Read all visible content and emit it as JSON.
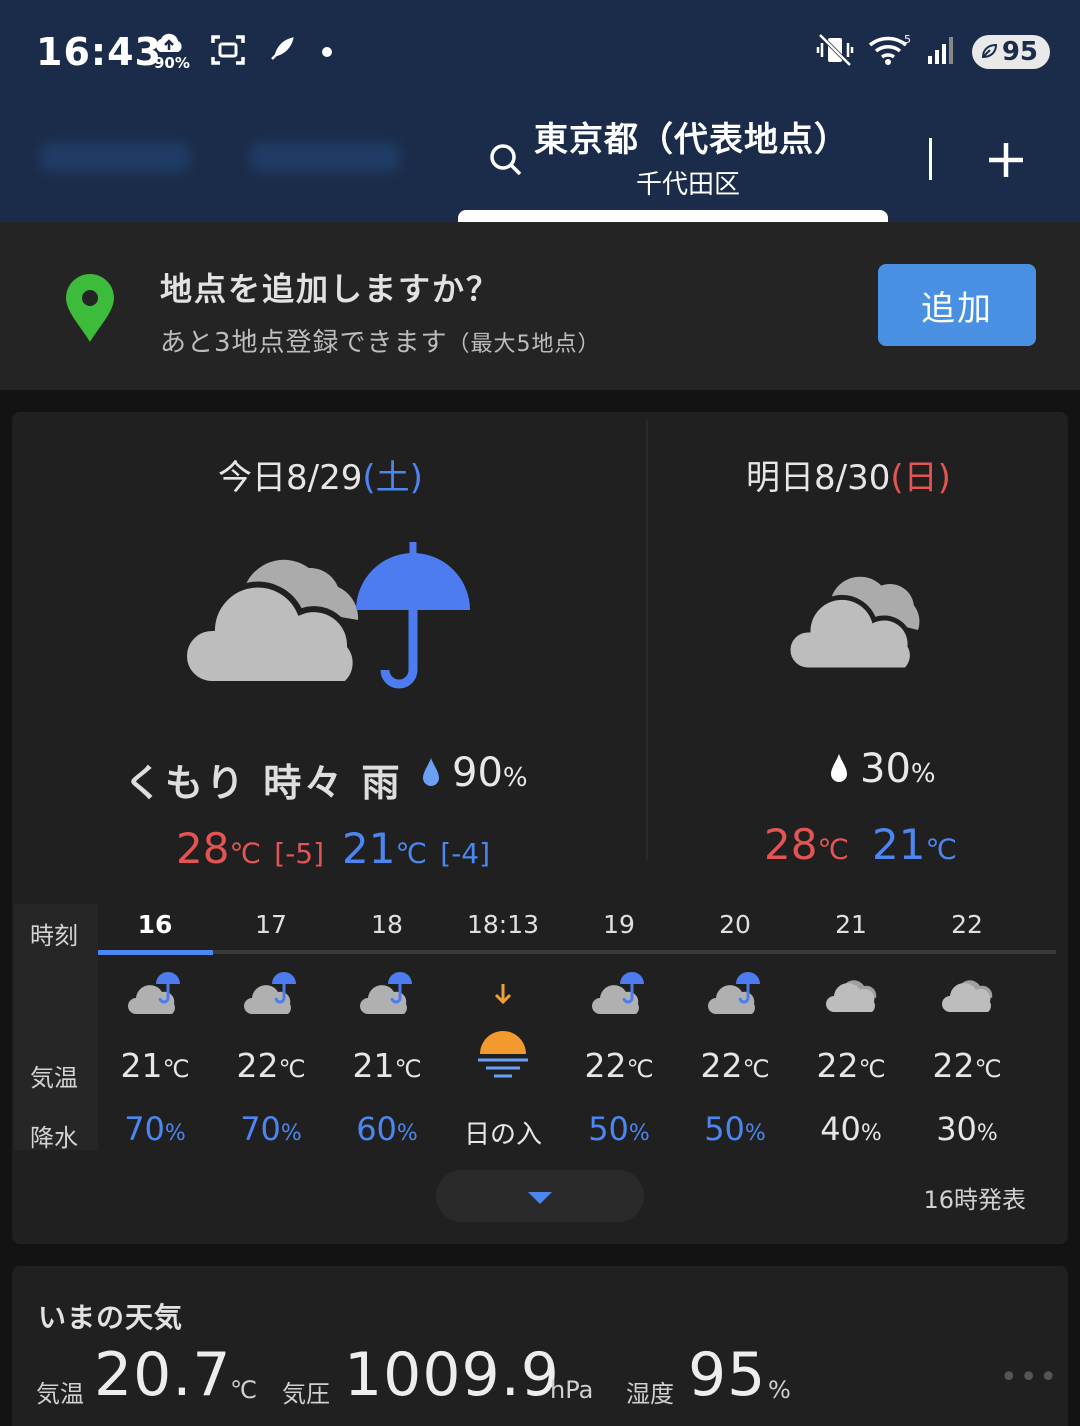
{
  "status_bar": {
    "time": "16:43",
    "cloud_percent": "90%",
    "battery": "95",
    "icons": [
      "cloud-upload-icon",
      "screenshot-icon",
      "rocket-icon",
      "dot-icon",
      "mute-vibrate-icon",
      "wifi-icon",
      "signal-icon",
      "battery-saver-icon"
    ]
  },
  "header": {
    "location_title": "東京都（代表地点）",
    "location_sub": "千代田区",
    "search_icon": "search-icon",
    "add_icon": "plus-icon"
  },
  "banner": {
    "title": "地点を追加しますか？",
    "sub_main": "あと3地点登録できます",
    "sub_note": "（最大5地点）",
    "add_button": "追加",
    "pin_color": "#3dbb3a"
  },
  "today": {
    "prefix": "今日8/29",
    "dow": "(土)",
    "condition": "くもり 時々 雨",
    "pop_value": "90",
    "pop_unit": "%",
    "high": "28",
    "high_unit": "℃",
    "high_diff": "[-5]",
    "low": "21",
    "low_unit": "℃",
    "low_diff": "[-4]"
  },
  "tomorrow": {
    "prefix": "明日8/30",
    "dow": "(日)",
    "pop_value": "30",
    "pop_unit": "%",
    "high": "28",
    "high_unit": "℃",
    "low": "21",
    "low_unit": "℃"
  },
  "hourly": {
    "label_time": "時刻",
    "label_temp": "気温",
    "label_precip": "降水",
    "hours": [
      {
        "time": "16",
        "temp": "21",
        "precip": "70",
        "icon": "cloud-rain-icon",
        "blue": true
      },
      {
        "time": "17",
        "temp": "22",
        "precip": "70",
        "icon": "cloud-rain-icon",
        "blue": true
      },
      {
        "time": "18",
        "temp": "21",
        "precip": "60",
        "icon": "cloud-rain-icon",
        "blue": true
      },
      {
        "time": "18:13",
        "temp": "",
        "precip": "日の入",
        "icon": "sunset-icon",
        "blue": false
      },
      {
        "time": "19",
        "temp": "22",
        "precip": "50",
        "icon": "cloud-rain-icon",
        "blue": true
      },
      {
        "time": "20",
        "temp": "22",
        "precip": "50",
        "icon": "cloud-rain-icon",
        "blue": true
      },
      {
        "time": "21",
        "temp": "22",
        "precip": "40",
        "icon": "cloud-icon",
        "blue": false
      },
      {
        "time": "22",
        "temp": "22",
        "precip": "30",
        "icon": "cloud-icon",
        "blue": false
      }
    ],
    "temp_unit": "℃",
    "precip_unit": "%",
    "issued": "16時発表"
  },
  "now": {
    "title": "いまの天気",
    "temp_label": "気温",
    "temp_value": "20.7",
    "temp_unit": "℃",
    "pressure_label": "気圧",
    "pressure_value": "1009.9",
    "pressure_unit": "hPa",
    "humidity_label": "湿度",
    "humidity_value": "95",
    "humidity_unit": "%"
  },
  "colors": {
    "header_bg": "#1b2c4a",
    "accent_blue": "#4c86f0",
    "accent_red": "#e35454",
    "button_blue": "#4a90e2"
  }
}
